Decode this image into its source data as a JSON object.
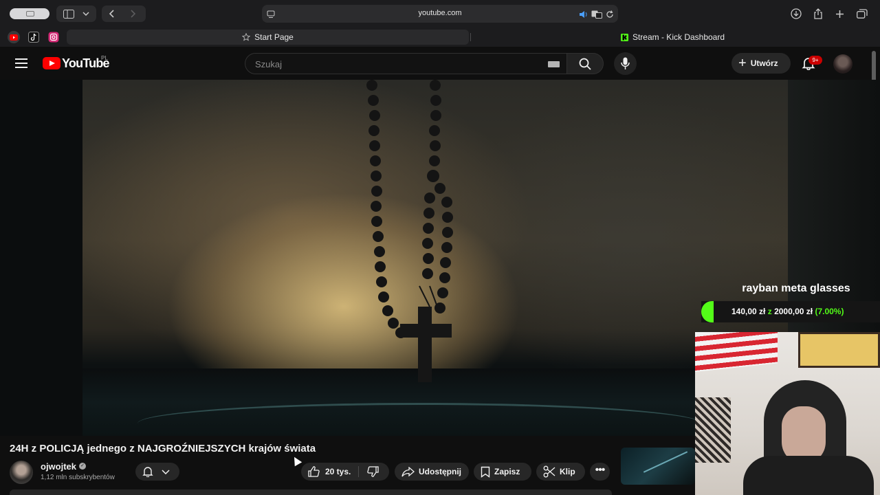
{
  "browser": {
    "url": "youtube.com",
    "tabs": [
      {
        "label": "Start Page",
        "icon": "star-icon"
      },
      {
        "label": "Stream - Kick Dashboard",
        "icon": "kick-icon"
      }
    ],
    "colors": {
      "toolbar": "#1c1c1e",
      "kick_accent": "#53fc18"
    }
  },
  "youtube": {
    "logo_text": "YouTube",
    "country_code": "PL",
    "search_placeholder": "Szukaj",
    "create_label": "Utwórz",
    "notification_count": "9+",
    "video": {
      "title": "24H z POLICJĄ jednego z NAJGROŹNIEJSZYCH krajów świata",
      "channel": "ojwojtek",
      "subscribers": "1,12 mln subskrybentów",
      "likes": "20 tys.",
      "share_label": "Udostępnij",
      "save_label": "Zapisz",
      "clip_label": "Klip",
      "more_label": "•••"
    },
    "brand_color": "#ff0000"
  },
  "overlay": {
    "goal_title": "rayban meta glasses",
    "goal_current": "140,00 zł",
    "goal_separator": "z",
    "goal_target": "2000,00 zł",
    "goal_percent": "(7.00%)",
    "goal_fraction": 0.07
  }
}
